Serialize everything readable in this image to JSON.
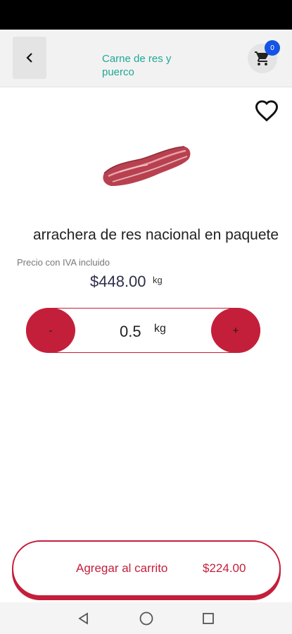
{
  "header": {
    "title": "Carne de res y puerco",
    "cart_count": "0"
  },
  "product": {
    "name": "arrachera de res nacional en paquete",
    "price_note": "Precio con IVA incluido",
    "price": "$448.00",
    "price_unit": "kg"
  },
  "quantity": {
    "minus_label": "-",
    "value": "0.5",
    "unit": "kg",
    "plus_label": "+"
  },
  "add_to_cart": {
    "label": "Agregar al carrito",
    "total": "$224.00"
  },
  "colors": {
    "accent": "#c41f3a",
    "title": "#1fa896",
    "badge": "#1553e6"
  },
  "icons": {
    "back": "chevron-left-icon",
    "cart": "shopping-cart-icon",
    "favorite": "heart-outline-icon",
    "nav_back": "triangle-back-icon",
    "nav_home": "circle-home-icon",
    "nav_recents": "square-recents-icon"
  }
}
